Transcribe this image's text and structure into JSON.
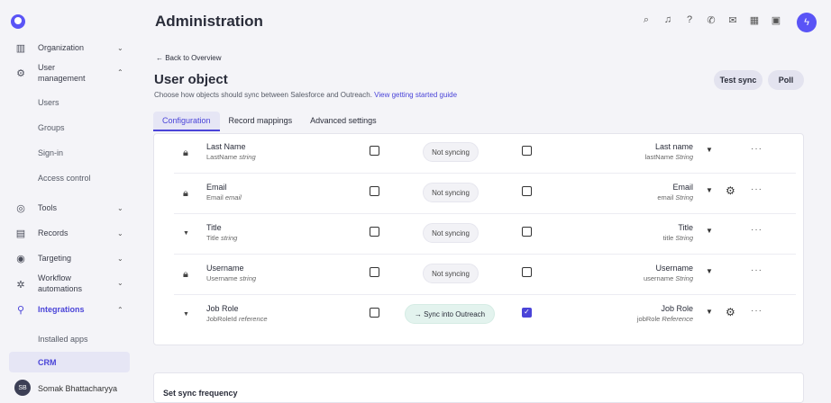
{
  "header": {
    "title": "Administration",
    "icons": [
      "search-icon",
      "bell-icon",
      "help-icon",
      "phone-icon",
      "mail-icon",
      "calendar-icon",
      "panel-icon",
      "bolt-icon"
    ]
  },
  "sidebar": {
    "items": [
      {
        "label": "Organization",
        "icon": "building-icon",
        "chevron": "⌄"
      },
      {
        "label": "User management",
        "icon": "users-gear-icon",
        "chevron": "⌃"
      },
      {
        "label": "Tools",
        "icon": "target-icon",
        "chevron": "⌄"
      },
      {
        "label": "Records",
        "icon": "records-icon",
        "chevron": "⌄"
      },
      {
        "label": "Targeting",
        "icon": "targeting-icon",
        "chevron": "⌄"
      },
      {
        "label": "Workflow automations",
        "icon": "workflow-icon",
        "chevron": "⌄"
      },
      {
        "label": "Integrations",
        "icon": "integrations-icon",
        "chevron": "⌃"
      }
    ],
    "user_management_sub": [
      "Users",
      "Groups",
      "Sign-in",
      "Access control"
    ],
    "integrations_sub": [
      "Installed apps",
      "CRM"
    ],
    "user": {
      "initials": "SB",
      "name": "Somak Bhattacharyya"
    }
  },
  "page": {
    "back": "← Back to Overview",
    "heading": "User object",
    "description": "Choose how objects should sync between Salesforce and Outreach.",
    "guide_link": "View getting started guide",
    "test_sync": "Test sync",
    "poll": "Poll",
    "tabs": [
      "Configuration",
      "Record mappings",
      "Advanced settings"
    ],
    "sync_frequency": "Set sync frequency"
  },
  "rows": [
    {
      "icon": "lock-icon",
      "name": "Last Name",
      "api": "LastName",
      "type": "string",
      "checkbox1": false,
      "status": "Not syncing",
      "syncing": false,
      "checkbox2": false,
      "target": "Last name",
      "target_api": "lastName",
      "target_type": "String",
      "gear": false
    },
    {
      "icon": "lock-icon",
      "name": "Email",
      "api": "Email",
      "type": "email",
      "checkbox1": false,
      "status": "Not syncing",
      "syncing": false,
      "checkbox2": false,
      "target": "Email",
      "target_api": "email",
      "target_type": "String",
      "gear": true
    },
    {
      "icon": "caret-icon",
      "name": "Title",
      "api": "Title",
      "type": "string",
      "checkbox1": false,
      "status": "Not syncing",
      "syncing": false,
      "checkbox2": false,
      "target": "Title",
      "target_api": "title",
      "target_type": "String",
      "gear": false
    },
    {
      "icon": "lock-icon",
      "name": "Username",
      "api": "Username",
      "type": "string",
      "checkbox1": false,
      "status": "Not syncing",
      "syncing": false,
      "checkbox2": false,
      "target": "Username",
      "target_api": "username",
      "target_type": "String",
      "gear": false
    },
    {
      "icon": "caret-icon",
      "name": "Job Role",
      "api": "JobRoleId",
      "type": "reference",
      "checkbox1": false,
      "status": "→ Sync into Outreach",
      "syncing": true,
      "checkbox2": true,
      "target": "Job Role",
      "target_api": "jobRole",
      "target_type": "Reference",
      "gear": true
    }
  ]
}
